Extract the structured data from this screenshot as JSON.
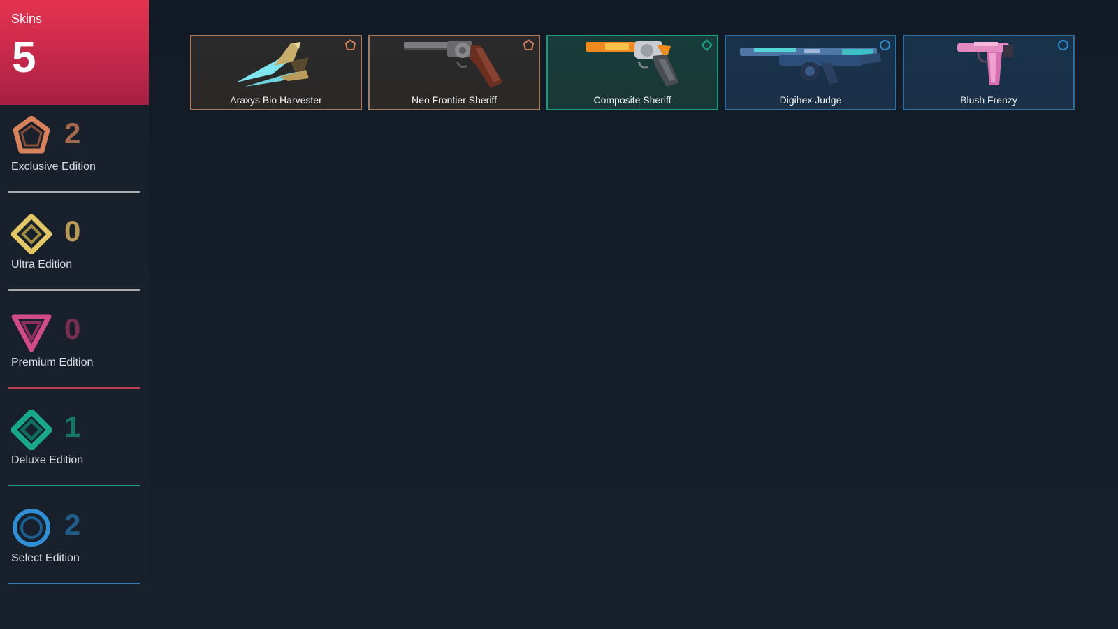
{
  "summary": {
    "label": "Skins",
    "count": "5"
  },
  "tiers": [
    {
      "key": "exclusive",
      "label": "Exclusive Edition",
      "count": "2",
      "icon": "exclusive-edition-icon",
      "color": "#d9825b"
    },
    {
      "key": "ultra",
      "label": "Ultra Edition",
      "count": "0",
      "icon": "ultra-edition-icon",
      "color": "#e3c766"
    },
    {
      "key": "premium",
      "label": "Premium Edition",
      "count": "0",
      "icon": "premium-edition-icon",
      "color": "#d14b87"
    },
    {
      "key": "deluxe",
      "label": "Deluxe Edition",
      "count": "1",
      "icon": "deluxe-edition-icon",
      "color": "#18a98d"
    },
    {
      "key": "select",
      "label": "Select Edition",
      "count": "2",
      "icon": "select-edition-icon",
      "color": "#2e8fd6"
    }
  ],
  "skins": [
    {
      "name": "Araxys Bio Harvester",
      "tier": "exclusive",
      "icon": "bio-harvester-knife-icon"
    },
    {
      "name": "Neo Frontier Sheriff",
      "tier": "exclusive",
      "icon": "revolver-icon"
    },
    {
      "name": "Composite Sheriff",
      "tier": "deluxe",
      "icon": "orange-revolver-icon"
    },
    {
      "name": "Digihex Judge",
      "tier": "select",
      "icon": "shotgun-icon"
    },
    {
      "name": "Blush Frenzy",
      "tier": "select",
      "icon": "pink-pistol-icon"
    }
  ]
}
